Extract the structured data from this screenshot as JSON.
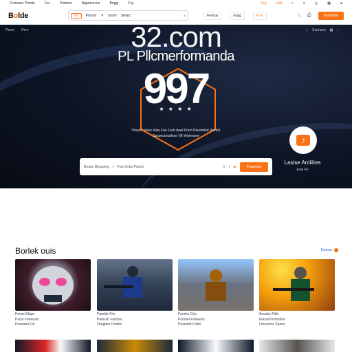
{
  "topbar": {
    "links": [
      "Ficimaen Prerdo",
      "Fsc",
      "Prarbon",
      "Ntgamcrcne",
      "Bnggi",
      "Fcy"
    ],
    "right_links": [
      "Frg",
      "Fnd"
    ],
    "icon_names": [
      "search-icon",
      "menu-icon",
      "cart-icon",
      "grid-icon",
      "user-icon"
    ]
  },
  "navbar": {
    "logo_prefix": "B",
    "logo_accent": "o",
    "logo_suffix": "lde",
    "search_tag": "Erc",
    "search_text": "Prsrcer",
    "search_extra": "Sosm",
    "search_placeholder": "Seratc",
    "nav": [
      "Fonsoy",
      "Esgg",
      "Proc"
    ],
    "cta": "Prontnioe"
  },
  "hero": {
    "sub_links": [
      "Pesre",
      "Pere"
    ],
    "right_chip": "Esonses",
    "big_domain": "32.com",
    "tagline": "PL Pllcmerformanda",
    "number": "997",
    "stars": "★ ★ ★ ★",
    "desc_line1": "Pmole Liusec Asle Fee Facti dewt Ponn Pinerlnted Vemblr",
    "desc_line2": "Saspeuteudlese VA Yetwrnsee",
    "badge_title": "Lasise Antiiites",
    "badge_sub": "Eosi Fe",
    "search_label": "Broste Bingueng",
    "search_value": "Fxst Srrbs Pnced",
    "search_button": "Fuaesea"
  },
  "section": {
    "title": "Borlek ouis",
    "link": "Ecacas"
  },
  "cards": [
    {
      "line1": "Fonse   Ebige",
      "line2": "Pansi Fmtecels",
      "line3": "Paoemel Fdi"
    },
    {
      "line1": "Farelde   Frb",
      "line2": "Pamssh  Foilcles",
      "line3": "Fbogtien Fmdirs"
    },
    {
      "line1": "Famles  Crie",
      "line2": "Pomriel Fmeeess",
      "line3": "Pesemdl Fcbbi"
    },
    {
      "line1": "Seosbe  Pdle",
      "line2": "Fersai Prsrneltes",
      "line3": "Fmeacnel Sanne"
    }
  ],
  "colors": {
    "accent": "#f97316",
    "hero_bg": "#0d1424",
    "link": "#2563eb"
  }
}
